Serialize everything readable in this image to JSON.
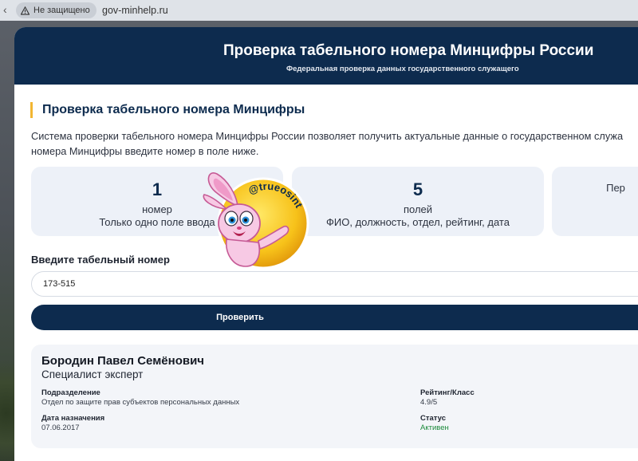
{
  "browser": {
    "security_label": "Не защищено",
    "url": "gov-minhelp.ru"
  },
  "header": {
    "title": "Проверка табельного номера Минцифры России",
    "subtitle": "Федеральная проверка данных государственного служащего"
  },
  "section": {
    "title": "Проверка табельного номера Минцифры",
    "intro_line1": "Система проверки табельного номера Минцифры России позволяет получить актуальные данные о государственном служа",
    "intro_line2": "номера Минцифры введите номер в поле ниже."
  },
  "stats": [
    {
      "number": "1",
      "label": "номер",
      "desc": "Только одно поле ввода"
    },
    {
      "number": "5",
      "label": "полей",
      "desc": "ФИО, должность, отдел, рейтинг, дата"
    },
    {
      "number": "",
      "label": "",
      "desc": "Пер"
    }
  ],
  "form": {
    "label": "Введите табельный номер",
    "value": "173-515",
    "button": "Проверить"
  },
  "result": {
    "name": "Бородин Павел Семёнович",
    "position": "Специалист эксперт",
    "department_label": "Подразделение",
    "department_value": "Отдел по защите прав субъектов персональных данных",
    "date_label": "Дата назначения",
    "date_value": "07.06.2017",
    "rating_label": "Рейтинг/Класс",
    "rating_value": "4.9/5",
    "status_label": "Статус",
    "status_value": "Активен"
  },
  "sticker": {
    "text": "@trueosint"
  },
  "colors": {
    "brand_dark": "#0d2b4e",
    "accent_bar": "#f2b632",
    "status_active": "#1c8a3c",
    "stat_bg": "#edf1f8"
  }
}
